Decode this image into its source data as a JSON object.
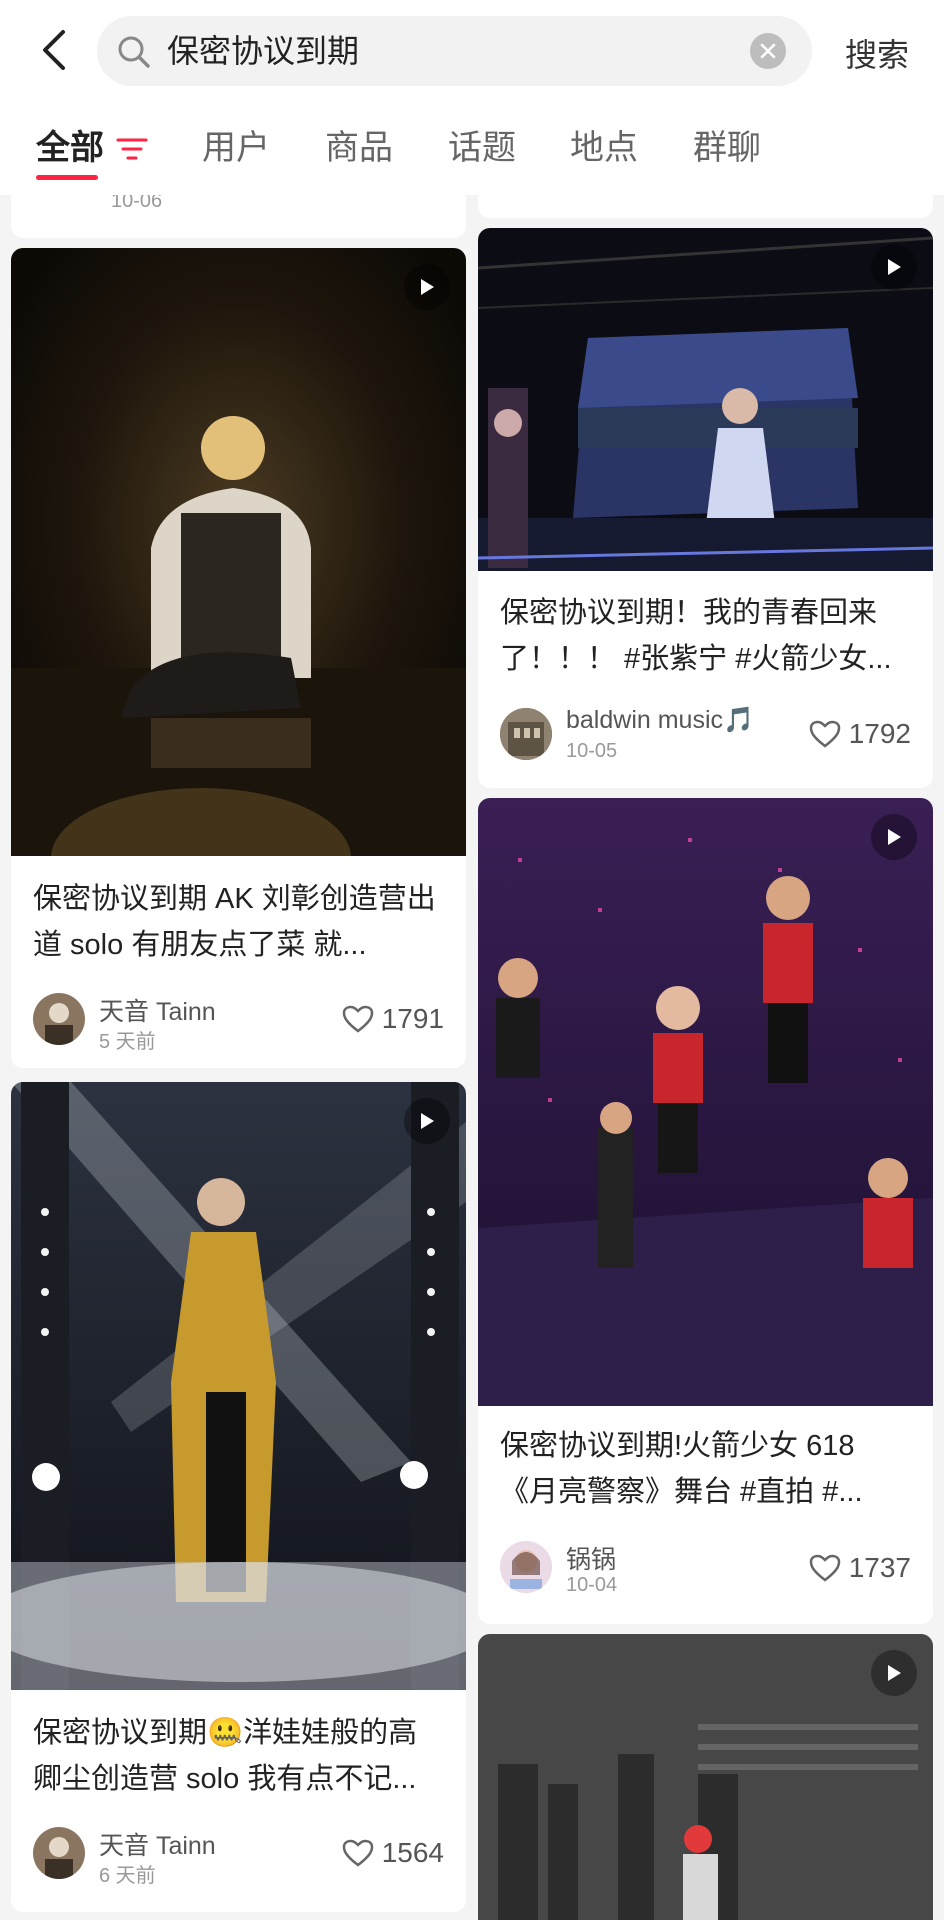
{
  "search": {
    "query": "保密协议到期",
    "button_label": "搜索"
  },
  "tabs": [
    {
      "label": "全部"
    },
    {
      "label": "用户"
    },
    {
      "label": "商品"
    },
    {
      "label": "话题"
    },
    {
      "label": "地点"
    },
    {
      "label": "群聊"
    }
  ],
  "partial_top_left": {
    "date": "10-06"
  },
  "cards": [
    {
      "title": "保密协议到期 AK 刘彰创造营出道 solo 有朋友点了菜 就...",
      "author": "天音 Tainn",
      "date": "5 天前",
      "likes": "1791"
    },
    {
      "title": "保密协议到期！我的青春回来了！！！ #张紫宁 #火箭少女...",
      "author": "baldwin music🎵",
      "date": "10-05",
      "likes": "1792"
    },
    {
      "title": "保密协议到期!火箭少女 618《月亮警察》舞台 #直拍 #...",
      "author": "锅锅",
      "date": "10-04",
      "likes": "1737"
    },
    {
      "title": "保密协议到期🤐洋娃娃般的高卿尘创造营 solo 我有点不记...",
      "author": "天音 Tainn",
      "date": "6 天前",
      "likes": "1564"
    }
  ],
  "colors": {
    "accent": "#ff2442",
    "background": "#f4f4f4",
    "card": "#ffffff"
  }
}
